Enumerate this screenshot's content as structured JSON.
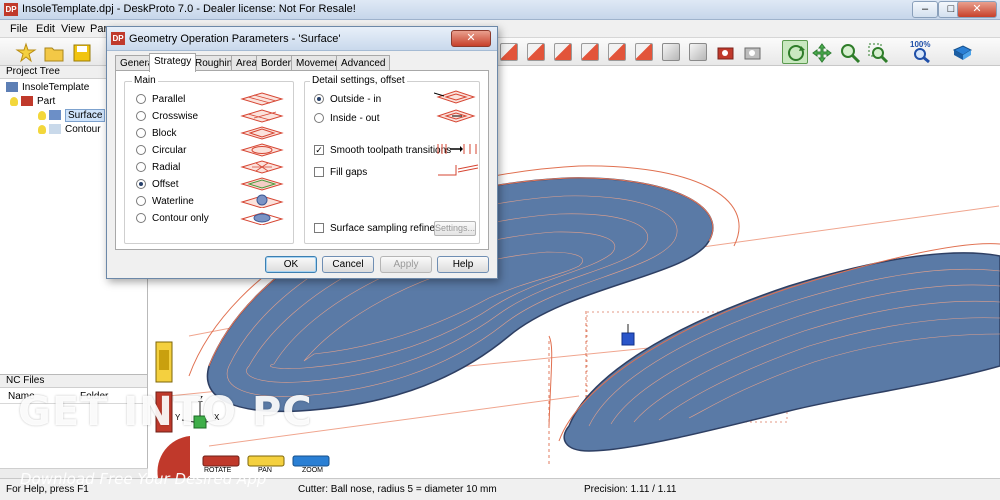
{
  "window": {
    "title": "InsoleTemplate.dpj - DeskProto 7.0 - Dealer license:  Not For Resale!",
    "app_icon_text": "DP",
    "minimize": "–",
    "maximize": "□",
    "close": "✕"
  },
  "menu": {
    "items": [
      "File",
      "Edit",
      "View",
      "Para"
    ]
  },
  "toolbar": {
    "zoom_label": "100%",
    "icons": [
      "new-project-icon",
      "open-folder-icon",
      "save-icon",
      "view-cube-icon",
      "rotate-view-icon",
      "pan-icon",
      "zoom-icon",
      "zoom-window-icon",
      "zoom-100-icon",
      "help-book-icon"
    ]
  },
  "project_tree": {
    "header": "Project Tree",
    "items": [
      {
        "label": "InsoleTemplate",
        "level": 0
      },
      {
        "label": "Part",
        "level": 1
      },
      {
        "label": "Surface",
        "level": 2,
        "selected": true
      },
      {
        "label": "Contour",
        "level": 2
      }
    ]
  },
  "nc_files": {
    "header": "NC Files",
    "columns": [
      "Name",
      "Folder"
    ]
  },
  "dialog": {
    "title": "Geometry Operation Parameters - 'Surface'",
    "icon_text": "DP",
    "close": "✕",
    "tabs": [
      "General",
      "Strategy",
      "Roughing",
      "Area",
      "Borders",
      "Movement",
      "Advanced"
    ],
    "active_tab": "Strategy",
    "main_group": {
      "title": "Main",
      "options": [
        "Parallel",
        "Crosswise",
        "Block",
        "Circular",
        "Radial",
        "Offset",
        "Waterline",
        "Contour only"
      ],
      "selected": "Offset"
    },
    "detail_group": {
      "title": "Detail settings, offset",
      "options": [
        "Outside - in",
        "Inside - out"
      ],
      "selected": "Outside - in",
      "smooth_label": "Smooth toolpath transitions",
      "smooth_checked": true,
      "fill_gaps_label": "Fill gaps",
      "fill_gaps_checked": false,
      "sampling_label": "Surface sampling refinement",
      "sampling_checked": false,
      "settings_button": "Settings..."
    },
    "buttons": {
      "ok": "OK",
      "cancel": "Cancel",
      "apply": "Apply",
      "help": "Help"
    }
  },
  "view_tools": {
    "labels": [
      "ROTATE",
      "PAN",
      "ZOOM"
    ],
    "axis_labels": [
      "Z",
      "Y",
      "X"
    ]
  },
  "status": {
    "help": "For Help, press F1",
    "cutter": "Cutter: Ball nose, radius 5 = diameter 10 mm",
    "precision": "Precision: 1.11 / 1.11"
  },
  "watermark": {
    "logo": "GET INTO PC",
    "tagline": "Download Free Your Desired App"
  },
  "colors": {
    "toolpath_blue": "#3c5a8c",
    "toolpath_orange": "#e9785a",
    "accent_red": "#c0392b",
    "selection": "#cfe3fb"
  }
}
